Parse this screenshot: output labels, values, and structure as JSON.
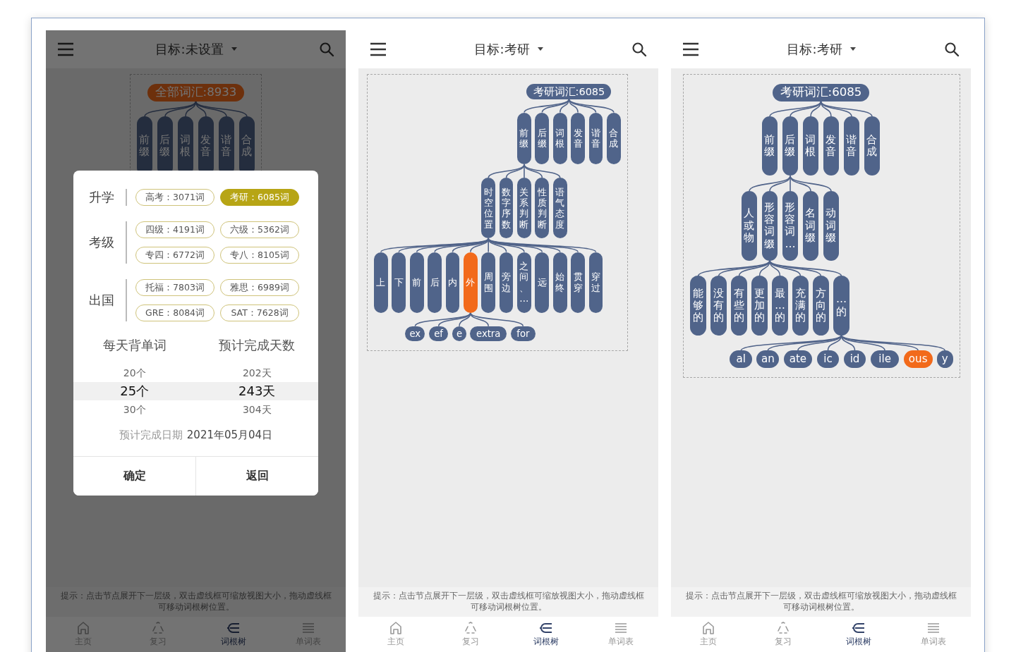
{
  "screens": [
    {
      "header": {
        "title": "目标:未设置"
      },
      "dimmed": true,
      "tree": {
        "text": "全部词汇:8933",
        "kind": "root",
        "selected": true,
        "children": [
          {
            "text": "前缀",
            "kind": "branch",
            "selected": false
          },
          {
            "text": "后缀",
            "kind": "branch",
            "selected": false
          },
          {
            "text": "词根",
            "kind": "branch",
            "selected": false
          },
          {
            "text": "发音",
            "kind": "branch",
            "selected": false
          },
          {
            "text": "谐音",
            "kind": "branch",
            "selected": false
          },
          {
            "text": "合成",
            "kind": "branch",
            "selected": false
          }
        ]
      },
      "dialog": {
        "groups": [
          {
            "label": "升学",
            "options": [
              {
                "text": "高考：3071词",
                "selected": false
              },
              {
                "text": "考研：6085词",
                "selected": true
              }
            ]
          },
          {
            "label": "考级",
            "options": [
              {
                "text": "四级：4191词",
                "selected": false
              },
              {
                "text": "六级：5362词",
                "selected": false
              },
              {
                "text": "专四：6772词",
                "selected": false
              },
              {
                "text": "专八：8105词",
                "selected": false
              }
            ]
          },
          {
            "label": "出国",
            "options": [
              {
                "text": "托福：7803词",
                "selected": false
              },
              {
                "text": "雅思：6989词",
                "selected": false
              },
              {
                "text": "GRE：8084词",
                "selected": false
              },
              {
                "text": "SAT：7628词",
                "selected": false
              }
            ]
          }
        ],
        "pickers": [
          {
            "title": "每天背单词",
            "items": [
              {
                "text": "20个",
                "selected": false
              },
              {
                "text": "25个",
                "selected": true
              },
              {
                "text": "30个",
                "selected": false
              }
            ]
          },
          {
            "title": "预计完成天数",
            "items": [
              {
                "text": "202天",
                "selected": false
              },
              {
                "text": "243天",
                "selected": true
              },
              {
                "text": "304天",
                "selected": false
              }
            ]
          }
        ],
        "completion": {
          "label": "预计完成日期",
          "value": "2021年05月04日"
        },
        "buttons": [
          "确定",
          "返回"
        ]
      },
      "hint": "提示：点击节点展开下一层级，双击虚线框可缩放视图大小，拖动虚线框可移动词根树位置。",
      "nav": [
        {
          "label": "主页",
          "selected": false
        },
        {
          "label": "复习",
          "selected": false
        },
        {
          "label": "词根树",
          "selected": true
        },
        {
          "label": "单词表",
          "selected": false
        }
      ]
    },
    {
      "header": {
        "title": "目标:考研"
      },
      "tree": {
        "text": "考研词汇:6085",
        "kind": "root",
        "selected": false,
        "children": [
          {
            "text": "前缀",
            "kind": "branch",
            "selected": false,
            "children": [
              {
                "text": "时空位置",
                "kind": "branch",
                "selected": false,
                "children": [
                  {
                    "text": "上",
                    "kind": "branch",
                    "selected": false
                  },
                  {
                    "text": "下",
                    "kind": "branch",
                    "selected": false
                  },
                  {
                    "text": "前",
                    "kind": "branch",
                    "selected": false
                  },
                  {
                    "text": "后",
                    "kind": "branch",
                    "selected": false
                  },
                  {
                    "text": "内",
                    "kind": "branch",
                    "selected": false
                  },
                  {
                    "text": "外",
                    "kind": "branch",
                    "selected": true,
                    "children": [
                      {
                        "text": "ex",
                        "kind": "affix",
                        "selected": false
                      },
                      {
                        "text": "ef",
                        "kind": "affix",
                        "selected": false
                      },
                      {
                        "text": "e",
                        "kind": "affix",
                        "selected": false
                      },
                      {
                        "text": "extra",
                        "kind": "affix",
                        "selected": false
                      },
                      {
                        "text": "for",
                        "kind": "affix",
                        "selected": false
                      }
                    ]
                  },
                  {
                    "text": "周围",
                    "kind": "branch",
                    "selected": false
                  },
                  {
                    "text": "旁边",
                    "kind": "branch",
                    "selected": false
                  },
                  {
                    "text": "之间、…",
                    "kind": "branch",
                    "selected": false
                  },
                  {
                    "text": "远",
                    "kind": "branch",
                    "selected": false
                  },
                  {
                    "text": "始终",
                    "kind": "branch",
                    "selected": false
                  },
                  {
                    "text": "贯穿",
                    "kind": "branch",
                    "selected": false
                  },
                  {
                    "text": "穿过",
                    "kind": "branch",
                    "selected": false
                  }
                ]
              },
              {
                "text": "数字序数",
                "kind": "branch",
                "selected": false
              },
              {
                "text": "关系判断",
                "kind": "branch",
                "selected": false
              },
              {
                "text": "性质判断",
                "kind": "branch",
                "selected": false
              },
              {
                "text": "语气态度",
                "kind": "branch",
                "selected": false
              }
            ]
          },
          {
            "text": "后缀",
            "kind": "branch",
            "selected": false
          },
          {
            "text": "词根",
            "kind": "branch",
            "selected": false
          },
          {
            "text": "发音",
            "kind": "branch",
            "selected": false
          },
          {
            "text": "谐音",
            "kind": "branch",
            "selected": false
          },
          {
            "text": "合成",
            "kind": "branch",
            "selected": false
          }
        ]
      },
      "hint": "提示：点击节点展开下一层级，双击虚线框可缩放视图大小，拖动虚线框可移动词根树位置。",
      "nav": [
        {
          "label": "主页",
          "selected": false
        },
        {
          "label": "复习",
          "selected": false
        },
        {
          "label": "词根树",
          "selected": true
        },
        {
          "label": "单词表",
          "selected": false
        }
      ]
    },
    {
      "header": {
        "title": "目标:考研"
      },
      "tree": {
        "text": "考研词汇:6085",
        "kind": "root",
        "selected": false,
        "children": [
          {
            "text": "前缀",
            "kind": "branch",
            "selected": false
          },
          {
            "text": "后缀",
            "kind": "branch",
            "selected": false,
            "children": [
              {
                "text": "人或物",
                "kind": "branch",
                "selected": false
              },
              {
                "text": "形容词缀",
                "kind": "branch",
                "selected": false,
                "children": [
                  {
                    "text": "能够的",
                    "kind": "branch",
                    "selected": false
                  },
                  {
                    "text": "没有的",
                    "kind": "branch",
                    "selected": false
                  },
                  {
                    "text": "有些的",
                    "kind": "branch",
                    "selected": false
                  },
                  {
                    "text": "更加的",
                    "kind": "branch",
                    "selected": false
                  },
                  {
                    "text": "最...的",
                    "kind": "branch",
                    "selected": false
                  },
                  {
                    "text": "充满的",
                    "kind": "branch",
                    "selected": false
                  },
                  {
                    "text": "方向的",
                    "kind": "branch",
                    "selected": false
                  },
                  {
                    "text": "…的",
                    "kind": "branch",
                    "selected": false,
                    "children": [
                      {
                        "text": "al",
                        "kind": "affix",
                        "selected": false
                      },
                      {
                        "text": "an",
                        "kind": "affix",
                        "selected": false
                      },
                      {
                        "text": "ate",
                        "kind": "affix",
                        "selected": false
                      },
                      {
                        "text": "ic",
                        "kind": "affix",
                        "selected": false
                      },
                      {
                        "text": "id",
                        "kind": "affix",
                        "selected": false
                      },
                      {
                        "text": "ile",
                        "kind": "affix",
                        "selected": false
                      },
                      {
                        "text": "ous",
                        "kind": "affix",
                        "selected": true
                      },
                      {
                        "text": "y",
                        "kind": "affix",
                        "selected": false
                      }
                    ]
                  }
                ]
              },
              {
                "text": "形容词…",
                "kind": "branch",
                "selected": false
              },
              {
                "text": "名词缀",
                "kind": "branch",
                "selected": false
              },
              {
                "text": "动词缀",
                "kind": "branch",
                "selected": false
              }
            ]
          },
          {
            "text": "词根",
            "kind": "branch",
            "selected": false
          },
          {
            "text": "发音",
            "kind": "branch",
            "selected": false
          },
          {
            "text": "谐音",
            "kind": "branch",
            "selected": false
          },
          {
            "text": "合成",
            "kind": "branch",
            "selected": false
          }
        ]
      },
      "hint": "提示：点击节点展开下一层级，双击虚线框可缩放视图大小，拖动虚线框可移动词根树位置。",
      "nav": [
        {
          "label": "主页",
          "selected": false
        },
        {
          "label": "复习",
          "selected": false
        },
        {
          "label": "词根树",
          "selected": true
        },
        {
          "label": "单词表",
          "selected": false
        }
      ]
    }
  ]
}
